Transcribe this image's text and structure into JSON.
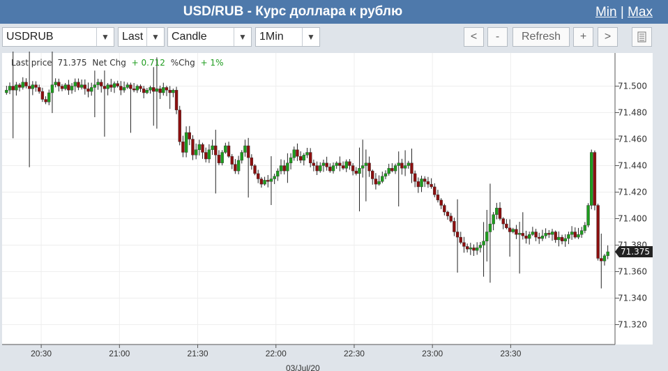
{
  "window": {
    "title": "USD/RUB - Курс доллара к рублю",
    "min_label": "Min",
    "sep": "|",
    "max_label": "Max"
  },
  "toolbar": {
    "symbol": "USDRUB",
    "field": "Last",
    "chart_style": "Candle",
    "interval": "1Min",
    "prev_label": "<",
    "zoom_out_label": "-",
    "refresh_label": "Refresh",
    "zoom_in_label": "+",
    "next_label": ">",
    "dropdown_arrow": "▼",
    "menu_icon": "list-icon"
  },
  "stats": {
    "last_price_label": "Last price",
    "last_price": "71.375",
    "net_chg_label": "Net Chg",
    "net_chg": "+ 0.712",
    "pct_chg_label": "%Chg",
    "pct_chg": "+ 1%"
  },
  "colors": {
    "up": "#1e9c1e",
    "down": "#8c0f0f",
    "title_bg": "#4e79ab",
    "toolbar_bg": "#dfe4ea"
  },
  "chart_data": {
    "type": "candlestick",
    "ylim": [
      71.305,
      71.525
    ],
    "yticks": [
      71.32,
      71.34,
      71.36,
      71.38,
      71.4,
      71.42,
      71.44,
      71.46,
      71.48,
      71.5
    ],
    "ytick_labels": [
      "71.320",
      "71.340",
      "71.360",
      "71.380",
      "71.400",
      "71.420",
      "71.440",
      "71.460",
      "71.480",
      "71.500"
    ],
    "xlim": [
      "20:15",
      "24:10"
    ],
    "xticks": [
      "20:30",
      "21:00",
      "21:30",
      "22:00",
      "22:30",
      "23:00",
      "23:30"
    ],
    "date_label": "03/Jul/20",
    "last_price_marker": "71.375",
    "grid": true,
    "ohlc_close": [
      71.497,
      71.5,
      71.497,
      71.501,
      71.499,
      71.503,
      71.5,
      71.498,
      71.501,
      71.499,
      71.496,
      71.49,
      71.488,
      71.495,
      71.501,
      71.503,
      71.5,
      71.498,
      71.501,
      71.497,
      71.5,
      71.503,
      71.499,
      71.501,
      71.498,
      71.496,
      71.499,
      71.501,
      71.503,
      71.5,
      71.498,
      71.501,
      71.499,
      71.502,
      71.5,
      71.497,
      71.499,
      71.501,
      71.498,
      71.497,
      71.5,
      71.498,
      71.495,
      71.497,
      71.499,
      71.496,
      71.498,
      71.495,
      71.499,
      71.497,
      71.495,
      71.497,
      71.482,
      71.458,
      71.45,
      71.465,
      71.46,
      71.448,
      71.452,
      71.456,
      71.45,
      71.445,
      71.452,
      71.455,
      71.448,
      71.442,
      71.45,
      71.455,
      71.447,
      71.441,
      71.436,
      71.444,
      71.45,
      71.455,
      71.446,
      71.44,
      71.434,
      71.43,
      71.426,
      71.429,
      71.428,
      71.43,
      71.432,
      71.436,
      71.44,
      71.436,
      71.442,
      71.446,
      71.452,
      71.447,
      71.444,
      71.448,
      71.45,
      71.442,
      71.44,
      71.436,
      71.44,
      71.442,
      71.439,
      71.436,
      71.44,
      71.442,
      71.44,
      71.438,
      71.443,
      71.44,
      71.436,
      71.434,
      71.438,
      71.44,
      71.442,
      71.436,
      71.43,
      71.426,
      71.428,
      71.432,
      71.434,
      71.438,
      71.436,
      71.44,
      71.442,
      71.438,
      71.44,
      71.442,
      71.434,
      71.428,
      71.424,
      71.43,
      71.428,
      71.426,
      71.424,
      71.418,
      71.414,
      71.41,
      71.405,
      71.402,
      71.398,
      71.39,
      71.386,
      71.382,
      71.379,
      71.377,
      71.378,
      71.376,
      71.378,
      71.38,
      71.383,
      71.39,
      71.396,
      71.403,
      71.408,
      71.4,
      71.396,
      71.393,
      71.39,
      71.392,
      71.388,
      71.389,
      71.387,
      71.385,
      71.388,
      71.39,
      71.386,
      71.385,
      71.387,
      71.389,
      71.388,
      71.39,
      71.384,
      71.386,
      71.383,
      71.385,
      71.388,
      71.39,
      71.386,
      71.388,
      71.391,
      71.395,
      71.41,
      71.45,
      71.41,
      71.37,
      71.368,
      71.372,
      71.375
    ]
  }
}
